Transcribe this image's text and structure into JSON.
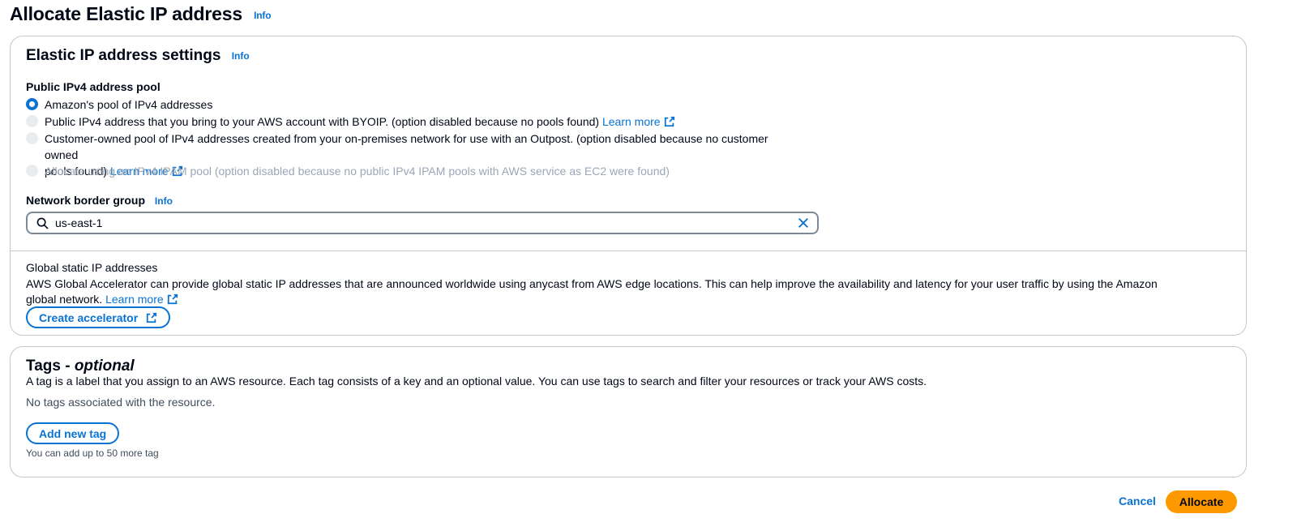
{
  "page": {
    "title": "Allocate Elastic IP address",
    "info": "Info"
  },
  "settings": {
    "title": "Elastic IP address settings",
    "info": "Info",
    "pool_label": "Public IPv4 address pool",
    "options": [
      {
        "text": "Amazon's pool of IPv4 addresses",
        "selected": true,
        "disabled": false,
        "link": ""
      },
      {
        "text": "Public IPv4 address that you bring to your AWS account with BYOIP. (option disabled because no pools found)",
        "selected": false,
        "disabled": true,
        "link": "Learn more"
      },
      {
        "text": "Customer-owned pool of IPv4 addresses created from your on-premises network for use with an Outpost. (option disabled because no customer owned",
        "text2": "pools found)",
        "selected": false,
        "disabled": true,
        "link": "Learn more"
      },
      {
        "text": "Allocate using an IPv4 IPAM pool (option disabled because no public IPv4 IPAM pools with AWS service as EC2 were found)",
        "selected": false,
        "disabled": true,
        "link": ""
      }
    ],
    "nbg_label": "Network border group",
    "nbg_info": "Info",
    "nbg_value": "us-east-1",
    "global_label": "Global static IP addresses",
    "global_desc": "AWS Global Accelerator can provide global static IP addresses that are announced worldwide using anycast from AWS edge locations. This can help improve the availability and latency for your user traffic by using the Amazon global network.",
    "global_learn_more": "Learn more",
    "create_accelerator": "Create accelerator"
  },
  "tags": {
    "title": "Tags - ",
    "title_optional": "optional",
    "desc": "A tag is a label that you assign to an AWS resource. Each tag consists of a key and an optional value. You can use tags to search and filter your resources or track your AWS costs.",
    "empty": "No tags associated with the resource.",
    "add_button": "Add new tag",
    "limit_note": "You can add up to 50 more tag"
  },
  "footer": {
    "cancel": "Cancel",
    "allocate": "Allocate"
  },
  "colors": {
    "link": "#0972d3",
    "primary_button": "#ff9900",
    "border": "#c6c6cd",
    "disabled_text": "#9ba7b6"
  }
}
